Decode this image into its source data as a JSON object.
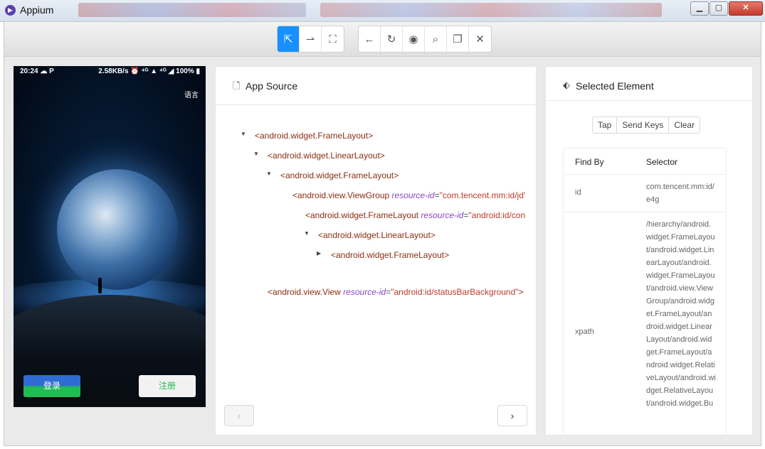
{
  "window": {
    "title": "Appium"
  },
  "toolbar": {
    "mode_buttons": [
      {
        "icon": "select-arrow-icon",
        "glyph": "⇱",
        "active": true
      },
      {
        "icon": "swipe-icon",
        "glyph": "⇀",
        "active": false
      },
      {
        "icon": "tap-coordinates-icon",
        "glyph": "⛶",
        "active": false
      }
    ],
    "action_buttons": [
      {
        "icon": "back-icon",
        "glyph": "←"
      },
      {
        "icon": "refresh-icon",
        "glyph": "↻"
      },
      {
        "icon": "eye-icon",
        "glyph": "◉"
      },
      {
        "icon": "search-icon",
        "glyph": "⌕"
      },
      {
        "icon": "copy-icon",
        "glyph": "❐"
      },
      {
        "icon": "close-icon",
        "glyph": "✕"
      }
    ]
  },
  "device": {
    "status_left": "20:24 ☁ P",
    "status_right": "2.58KB/s ⏰ ⁴ᴳ ▲ ⁴ᴳ ◢ 100% ▮",
    "language_label": "语言",
    "login_label": "登录",
    "register_label": "注册"
  },
  "app_source": {
    "title": "App Source",
    "nodes": [
      {
        "tag": "<android.widget.FrameLayout>",
        "attr": "",
        "val": "",
        "close": "",
        "caret": "down"
      },
      {
        "tag": "<android.widget.LinearLayout>",
        "attr": "",
        "val": "",
        "close": "",
        "caret": "down"
      },
      {
        "tag": "<android.widget.FrameLayout>",
        "attr": "",
        "val": "",
        "close": "",
        "caret": "down"
      },
      {
        "tag": "<android.view.ViewGroup ",
        "attr": "resource-id",
        "val": "\"com.tencent.mm:id/jd'",
        "close": "",
        "caret": "down"
      },
      {
        "tag": "<android.widget.FrameLayout ",
        "attr": "resource-id",
        "val": "\"android:id/con",
        "close": "",
        "caret": "down"
      },
      {
        "tag": "<android.widget.LinearLayout>",
        "attr": "",
        "val": "",
        "close": "",
        "caret": "down"
      },
      {
        "tag": "<android.widget.FrameLayout>",
        "attr": "",
        "val": "",
        "close": "",
        "caret": "right"
      },
      {
        "tag": "<android.view.View ",
        "attr": "resource-id",
        "val": "\"android:id/statusBarBackground\"",
        "close": ">",
        "caret": "none"
      }
    ]
  },
  "selected_element": {
    "title": "Selected Element",
    "actions": [
      "Tap",
      "Send Keys",
      "Clear"
    ],
    "columns": [
      "Find By",
      "Selector"
    ],
    "rows": [
      {
        "by": "id",
        "selector": "com.tencent.mm:id/e4g"
      },
      {
        "by": "xpath",
        "selector": "/hierarchy/android.widget.FrameLayout/android.widget.LinearLayout/android.widget.FrameLayout/android.view.ViewGroup/android.widget.FrameLayout/android.widget.LinearLayout/android.widget.FrameLayout/android.widget.RelativeLayout/android.widget.RelativeLayout/android.widget.Bu"
      }
    ]
  }
}
